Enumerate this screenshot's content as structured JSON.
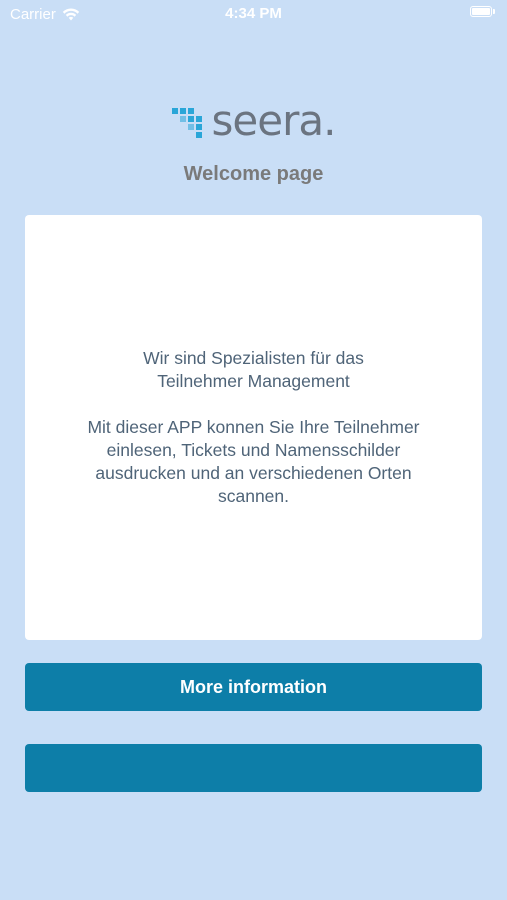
{
  "status_bar": {
    "carrier": "Carrier",
    "time": "4:34 PM"
  },
  "logo": {
    "text": "seera.",
    "mark_color": "#2aa6d8",
    "text_color": "#6b7480"
  },
  "page": {
    "title": "Welcome page"
  },
  "card": {
    "intro_line1": "Wir sind Spezialisten für das",
    "intro_line2": "Teilnehmer Management",
    "body_line1": "Mit dieser APP konnen Sie Ihre Teilnehmer",
    "body_line2": "einlesen, Tickets und Namensschilder",
    "body_line3": "ausdrucken und an verschiedenen Orten",
    "body_line4": "scannen."
  },
  "buttons": {
    "more_info_label": "More information",
    "second_label": ""
  },
  "colors": {
    "background": "#c9def6",
    "button": "#0d7ea8"
  }
}
